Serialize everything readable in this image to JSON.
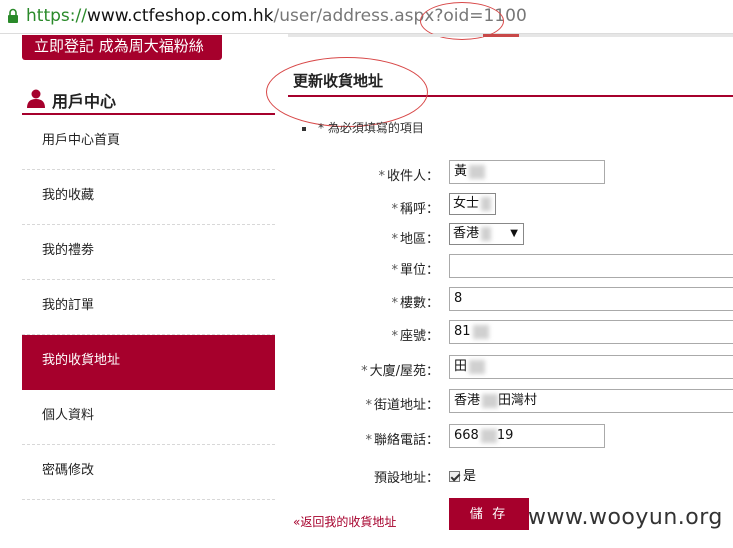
{
  "browser": {
    "url_scheme": "https://",
    "url_host": "www.ctfeshop.com.hk",
    "url_path": "/user/address.aspx?oid=1100"
  },
  "sidebar": {
    "register_banner": "立即登記 成為周大福粉絲",
    "section_title": "用戶中心",
    "items": [
      {
        "label": "用戶中心首頁"
      },
      {
        "label": "我的收藏"
      },
      {
        "label": "我的禮劵"
      },
      {
        "label": "我的訂單"
      },
      {
        "label": "我的收貨地址"
      },
      {
        "label": "個人資料"
      },
      {
        "label": "密碼修改"
      }
    ],
    "active_index": 4
  },
  "form": {
    "title": "更新收貨地址",
    "required_note": "* 為必須填寫的項目",
    "fields": {
      "recipient": {
        "label": "收件人：",
        "value": "黃"
      },
      "salutation": {
        "label": "稱呼：",
        "value": "女士"
      },
      "region": {
        "label": "地區：",
        "value": "香港"
      },
      "unit": {
        "label": "單位：",
        "value": ""
      },
      "floor": {
        "label": "樓數：",
        "value": "8"
      },
      "block": {
        "label": "座號：",
        "value": "81"
      },
      "building": {
        "label": "大廈/屋苑：",
        "value": "田"
      },
      "street": {
        "label": "街道地址：",
        "value_a": "香港",
        "value_b": "田灣村"
      },
      "phone": {
        "label": "聯絡電話：",
        "value_a": "668",
        "value_b": "19"
      },
      "default": {
        "label": "預設地址：",
        "checkbox_label": "是"
      }
    },
    "back_link": "«返回我的收貨地址",
    "save_button": "儲 存"
  },
  "watermark": "www.wooyun.org",
  "colors": {
    "brand": "#a6002c",
    "annotation": "#d84848",
    "url_scheme": "#2a8a2a"
  }
}
